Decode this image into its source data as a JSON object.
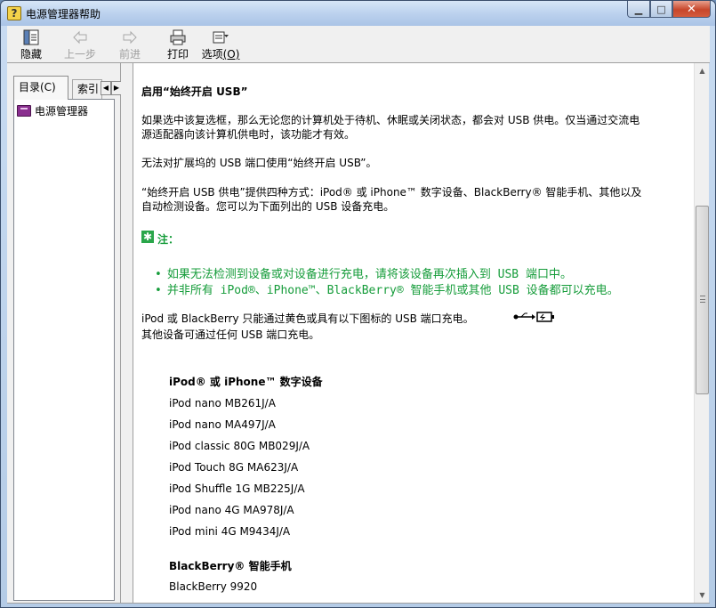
{
  "window": {
    "title": "电源管理器帮助"
  },
  "toolbar": {
    "hide": "隐藏",
    "back": "上一步",
    "forward": "前进",
    "print": "打印",
    "options_text": "选项",
    "options_key": "(O)"
  },
  "left": {
    "tab_contents": "目录(C)",
    "tab_index": "索引",
    "tree_item": "电源管理器"
  },
  "content": {
    "heading": "启用“始终开启 USB”",
    "p1_line1": "如果选中该复选框，那么无论您的计算机处于待机、休眠或关闭状态，都会对 USB 供电。仅当通过交流电",
    "p1_line2": "源适配器向该计算机供电时，该功能才有效。",
    "p2": "无法对扩展坞的 USB 端口使用“始终开启 USB”。",
    "p3_line1": "“始终开启 USB 供电”提供四种方式：iPod® 或 iPhone™ 数字设备、BlackBerry® 智能手机、其他以及",
    "p3_line2": "自动检测设备。您可以为下面列出的 USB 设备充电。",
    "note_label": "注：",
    "note1": "如果无法检测到设备或对设备进行充电，请将该设备再次插入到 USB 端口中。",
    "note2": "并非所有 iPod®、iPhone™、BlackBerry® 智能手机或其他 USB 设备都可以充电。",
    "p4_line1": "iPod 或 BlackBerry 只能通过黄色或具有以下图标的 USB 端口充电。",
    "p4_line2": "其他设备可通过任何 USB 端口充电。",
    "section1_title": "iPod® 或 iPhone™ 数字设备",
    "section1_items": [
      "iPod nano MB261J/A",
      "iPod nano MA497J/A",
      "iPod classic 80G MB029J/A",
      "iPod Touch 8G MA623J/A",
      "iPod Shuffle 1G MB225J/A",
      "iPod nano 4G MA978J/A",
      "iPod mini 4G M9434J/A"
    ],
    "section2_title": "BlackBerry® 智能手机",
    "section2_items": [
      "BlackBerry 9920"
    ]
  },
  "colors": {
    "note_green": "#159c3a",
    "titlebar": "#bcd2ee"
  }
}
